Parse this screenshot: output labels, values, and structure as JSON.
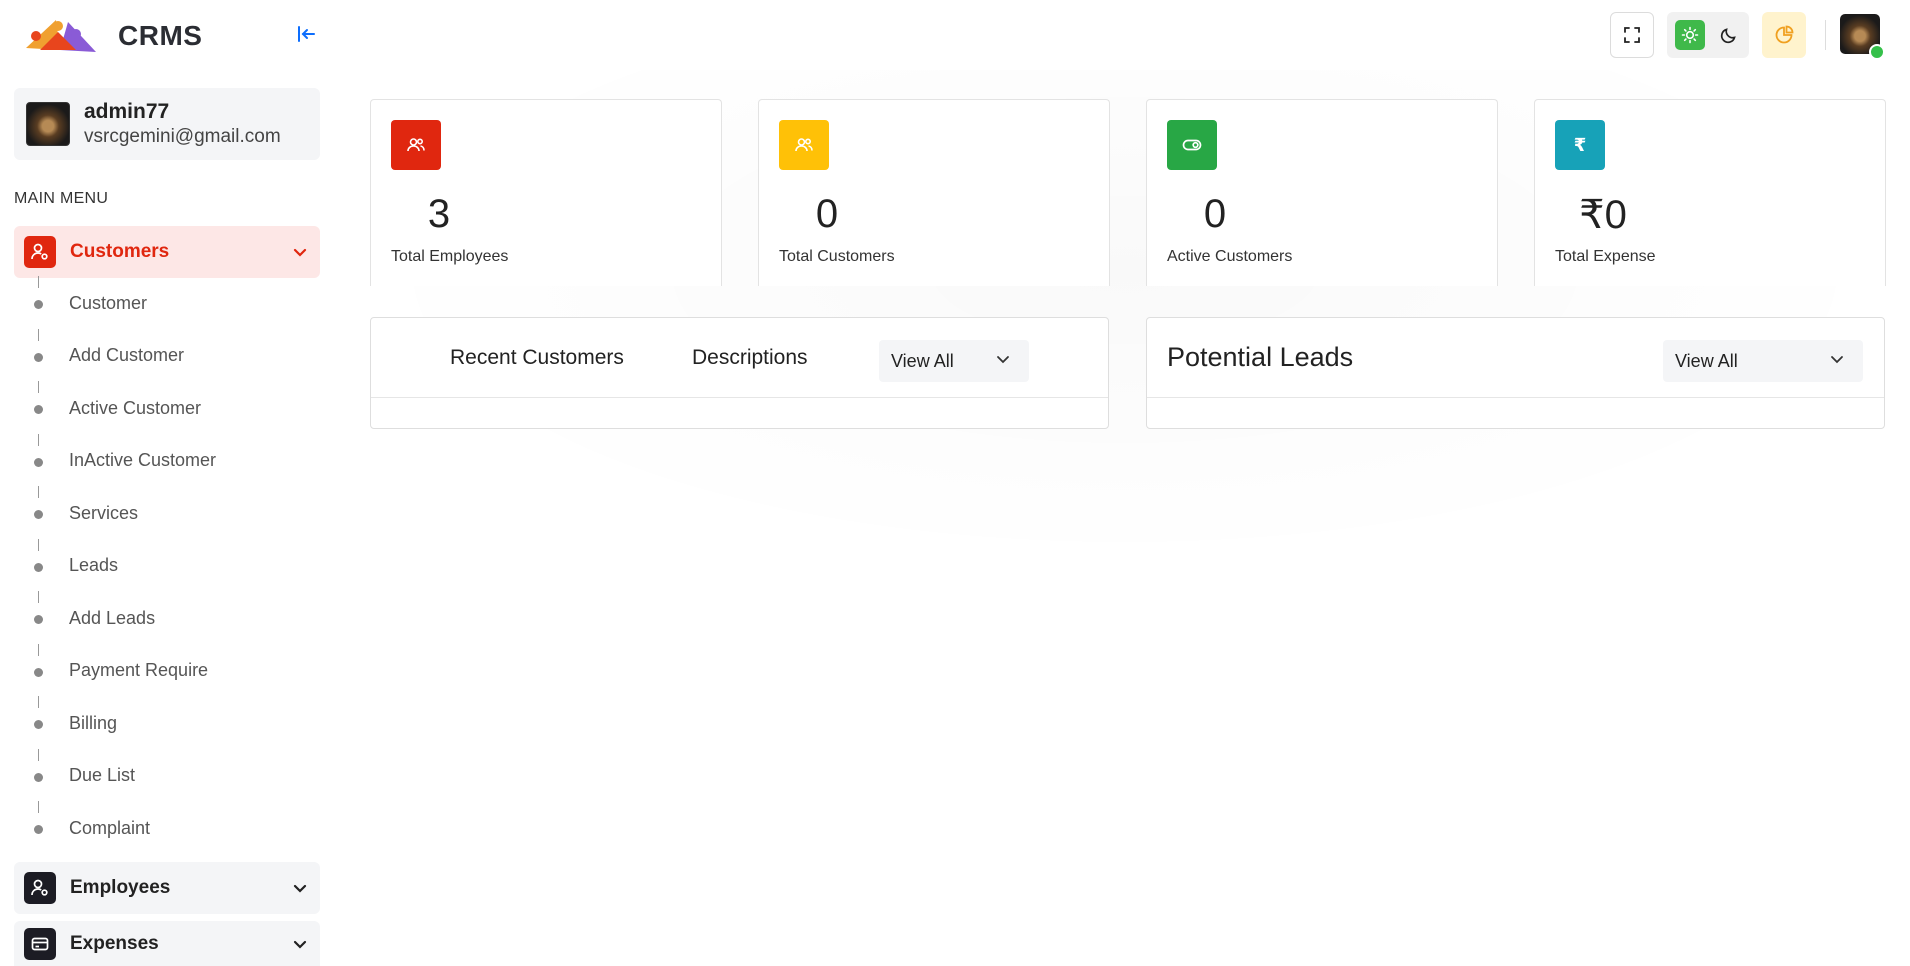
{
  "app": {
    "name": "CRMS"
  },
  "profile": {
    "name": "admin77",
    "email": "vsrcgemini@gmail.com"
  },
  "sidebar": {
    "caption": "MAIN MENU",
    "groups": [
      {
        "label": "Customers",
        "expanded": true
      },
      {
        "label": "Employees",
        "expanded": false
      },
      {
        "label": "Expenses",
        "expanded": false
      }
    ],
    "customer_items": [
      {
        "label": "Customer"
      },
      {
        "label": "Add Customer"
      },
      {
        "label": "Active Customer"
      },
      {
        "label": "InActive Customer"
      },
      {
        "label": "Services"
      },
      {
        "label": "Leads"
      },
      {
        "label": "Add Leads"
      },
      {
        "label": "Payment Require"
      },
      {
        "label": "Billing"
      },
      {
        "label": "Due List"
      },
      {
        "label": "Complaint"
      }
    ]
  },
  "stats": [
    {
      "value": "3",
      "label": "Total Employees",
      "color": "#e0270f",
      "icon": "users-icon"
    },
    {
      "value": "0",
      "label": "Total Customers",
      "color": "#ffc107",
      "icon": "users-icon"
    },
    {
      "value": "0",
      "label": "Active Customers",
      "color": "#28a745",
      "icon": "toggle-icon"
    },
    {
      "value": "₹0",
      "label": "Total Expense",
      "color": "#17a2b8",
      "icon": "rupee-icon"
    }
  ],
  "stat_icon_glyph_rupee": "₹",
  "recent_panel": {
    "tab1": "Recent Customers",
    "tab2": "Descriptions",
    "view_all": "View All"
  },
  "leads_panel": {
    "title": "Potential Leads",
    "view_all": "View All"
  },
  "colors": {
    "accent": "#e0270f",
    "active_bg": "#fde7e6",
    "theme_light": "#3fb94a",
    "chart_btn_bg": "#fff3cd",
    "online": "#35c04a"
  }
}
